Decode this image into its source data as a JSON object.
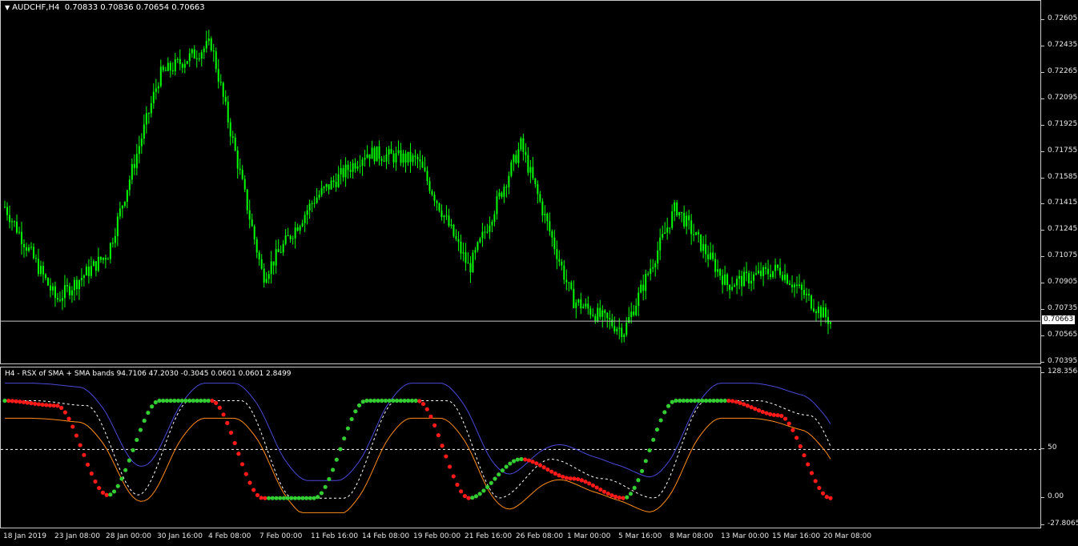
{
  "chart_header": {
    "symbol_timeframe": "AUDCHF,H4",
    "ohlc": "0.70833 0.70836 0.70654 0.70663",
    "dropdown_icon": "triangle-down-icon"
  },
  "price_axis": {
    "labels": [
      "0.72605",
      "0.72435",
      "0.72265",
      "0.72095",
      "0.71925",
      "0.71755",
      "0.71585",
      "0.71415",
      "0.71245",
      "0.71075",
      "0.70905",
      "0.70735",
      "0.70565",
      "0.70395"
    ],
    "current_price": "0.70663"
  },
  "indicator": {
    "title": "H4 - RSX of SMA + SMA bands 94.7106 47.2030 -0.3045 0.0601 0.0601 2.8499",
    "axis_labels": [
      "128.3568",
      "50",
      "0.00",
      "-27.8065"
    ],
    "level_line": 50,
    "colors": {
      "up_dots": "#33cc33",
      "down_dots": "#ff1a1a",
      "upper_band": "#4a4ad8",
      "lower_band": "#ff8c1a",
      "middle": "#ffffff"
    }
  },
  "time_axis": {
    "labels": [
      "18 Jan 2019",
      "23 Jan 08:00",
      "28 Jan 00:00",
      "30 Jan 16:00",
      "4 Feb 08:00",
      "7 Feb 00:00",
      "11 Feb 16:00",
      "14 Feb 08:00",
      "19 Feb 00:00",
      "21 Feb 16:00",
      "26 Feb 08:00",
      "1 Mar 00:00",
      "5 Mar 16:00",
      "8 Mar 08:00",
      "13 Mar 00:00",
      "15 Mar 16:00",
      "20 Mar 08:00"
    ]
  },
  "colors": {
    "background": "#000000",
    "candles": "#00ff00",
    "grid": "#c8c8c8",
    "price_line": "#c8c8c8"
  },
  "chart_data": {
    "type": "line",
    "title": "AUDCHF,H4",
    "xlabel": "",
    "ylabel": "",
    "x": [
      "18 Jan 2019",
      "23 Jan 08:00",
      "28 Jan 00:00",
      "30 Jan 16:00",
      "4 Feb 08:00",
      "7 Feb 00:00",
      "11 Feb 16:00",
      "14 Feb 08:00",
      "19 Feb 00:00",
      "21 Feb 16:00",
      "26 Feb 08:00",
      "1 Mar 00:00",
      "5 Mar 16:00",
      "8 Mar 08:00",
      "13 Mar 00:00",
      "15 Mar 16:00",
      "20 Mar 08:00"
    ],
    "ylim": [
      0.70395,
      0.72605
    ],
    "series": [
      {
        "name": "AUDCHF,H4",
        "values": [
          0.714,
          0.708,
          0.711,
          0.7225,
          0.7245,
          0.7095,
          0.7145,
          0.7175,
          0.717,
          0.71,
          0.718,
          0.708,
          0.706,
          0.714,
          0.709,
          0.71,
          0.7066
        ]
      }
    ],
    "indicator_ylim": [
      -27.8065,
      128.3568
    ],
    "indicator_series": [
      {
        "name": "RSX",
        "values": [
          100,
          95,
          3,
          100,
          100,
          0,
          0,
          100,
          100,
          0,
          40,
          20,
          0,
          100,
          100,
          85,
          0
        ]
      }
    ]
  }
}
